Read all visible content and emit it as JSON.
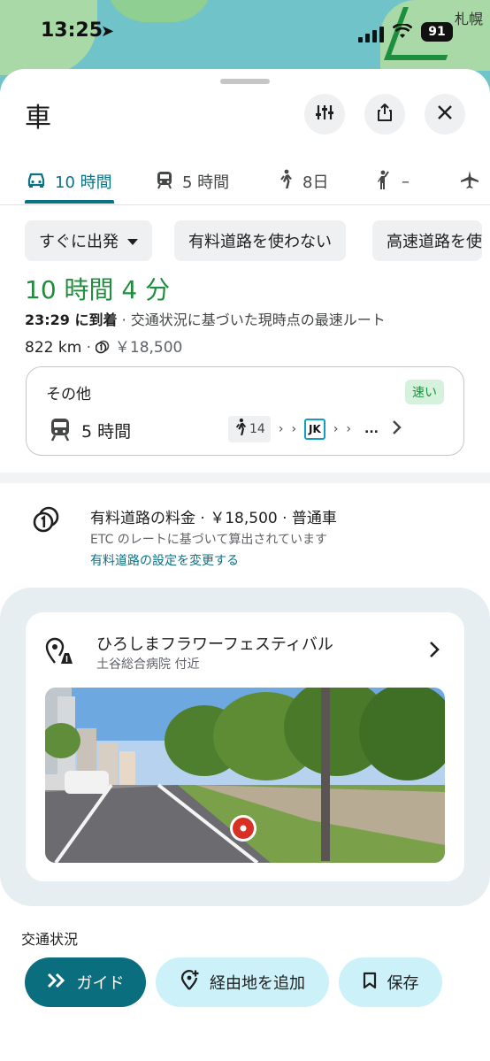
{
  "status_bar": {
    "time": "13:25",
    "battery": "91"
  },
  "map": {
    "city_label": "札幌"
  },
  "header": {
    "title": "車"
  },
  "tabs": [
    {
      "label": "10 時間",
      "mode": "car",
      "active": true
    },
    {
      "label": "5 時間",
      "mode": "transit",
      "active": false
    },
    {
      "label": "8日",
      "mode": "walk",
      "active": false
    },
    {
      "label": "–",
      "mode": "hail",
      "active": false
    },
    {
      "label": "",
      "mode": "flight",
      "active": false
    }
  ],
  "chips": {
    "depart": "すぐに出発",
    "avoid_tolls": "有料道路を使わない",
    "avoid_highways": "高速道路を使"
  },
  "route": {
    "duration": "10 時間 4 分",
    "arrival_time": "23:29 に到着",
    "arrival_note": " · 交通状況に基づいた現時点の最速ルート",
    "distance": "822 km",
    "toll_price": "￥18,500"
  },
  "alternative": {
    "title": "その他",
    "badge": "速い",
    "time": "5 時間",
    "walk_minutes": "14",
    "line_code": "JK",
    "ellipsis": "..."
  },
  "toll": {
    "title": "有料道路の料金 · ￥18,500 · 普通車",
    "subtitle": "ETC のレートに基づいて算出されています",
    "link": "有料道路の設定を変更する"
  },
  "festival": {
    "title": "ひろしまフラワーフェスティバル",
    "subtitle": "土谷総合病院 付近"
  },
  "traffic_label": "交通状況",
  "actions": {
    "guide": "ガイド",
    "add_stop": "経由地を追加",
    "save": "保存"
  },
  "colors": {
    "accent": "#0b7285",
    "duration_green": "#1e8e3e",
    "guide_button": "#0b6e7f",
    "light_button": "#cdf1f8"
  }
}
